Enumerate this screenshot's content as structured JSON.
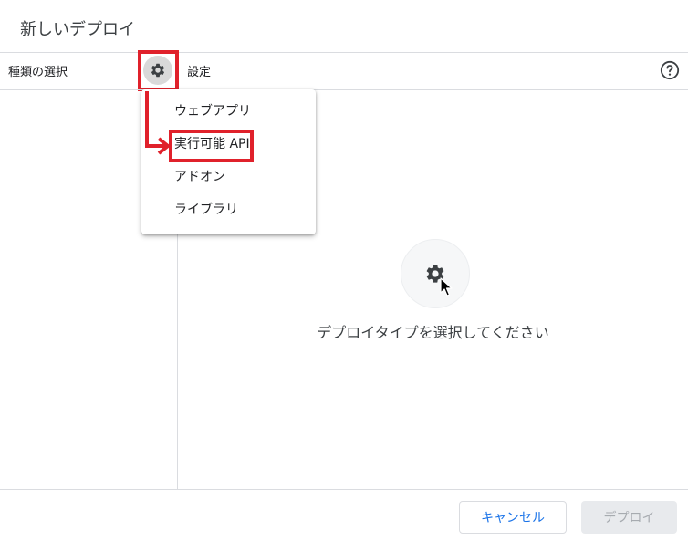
{
  "dialog": {
    "title": "新しいデプロイ"
  },
  "header": {
    "select_type_label": "種類の選択",
    "settings_label": "設定",
    "gear_icon": "gear-icon",
    "help_icon": "help-circle-icon"
  },
  "type_menu": {
    "items": [
      {
        "label": "ウェブアプリ"
      },
      {
        "label": "実行可能 API"
      },
      {
        "label": "アドオン"
      },
      {
        "label": "ライブラリ"
      }
    ]
  },
  "empty_state": {
    "icon": "gear-icon",
    "message": "デプロイタイプを選択してください"
  },
  "footer": {
    "cancel_label": "キャンセル",
    "deploy_label": "デプロイ"
  },
  "annotation": {
    "highlight_color": "#e0212b"
  },
  "colors": {
    "accent": "#1a73e8",
    "divider": "#dadce0",
    "disabled_bg": "#e8eaed",
    "disabled_text": "#a7abb0"
  }
}
